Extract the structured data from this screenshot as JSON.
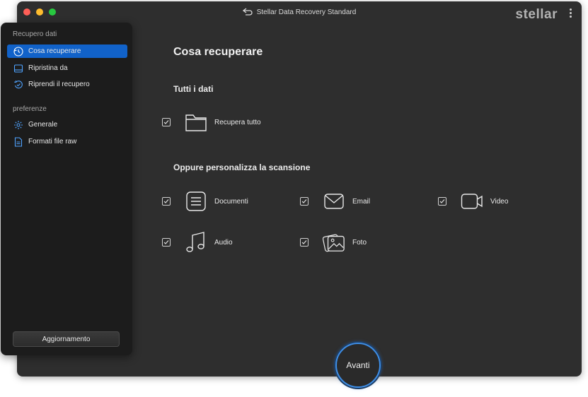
{
  "window": {
    "title": "Stellar Data Recovery Standard",
    "brand": "stellar",
    "traffic_colors": [
      "#ff5f57",
      "#febc2e",
      "#28c840"
    ]
  },
  "sidebar": {
    "section_recovery": "Recupero dati",
    "items": [
      {
        "label": "Cosa recuperare",
        "icon": "recover-icon",
        "active": true
      },
      {
        "label": "Ripristina da",
        "icon": "drive-icon",
        "active": false
      },
      {
        "label": "Riprendi il recupero",
        "icon": "resume-icon",
        "active": false
      }
    ],
    "section_prefs": "preferenze",
    "pref_items": [
      {
        "label": "Generale",
        "icon": "gear-icon"
      },
      {
        "label": "Formati file raw",
        "icon": "raw-file-icon"
      }
    ],
    "update_button": "Aggiornamento"
  },
  "main": {
    "title": "Cosa recuperare",
    "all_data_heading": "Tutti i dati",
    "recover_all": {
      "label": "Recupera tutto",
      "checked": true
    },
    "customize_heading": "Oppure personalizza la scansione",
    "options": [
      {
        "label": "Documenti",
        "icon": "document-icon",
        "checked": true
      },
      {
        "label": "Email",
        "icon": "email-icon",
        "checked": true
      },
      {
        "label": "Video",
        "icon": "video-icon",
        "checked": true
      },
      {
        "label": "Audio",
        "icon": "music-icon",
        "checked": true
      },
      {
        "label": "Foto",
        "icon": "photo-icon",
        "checked": true
      }
    ]
  },
  "next_button": "Avanti",
  "colors": {
    "accent": "#1162c9",
    "next_ring": "#3e8ee6"
  }
}
